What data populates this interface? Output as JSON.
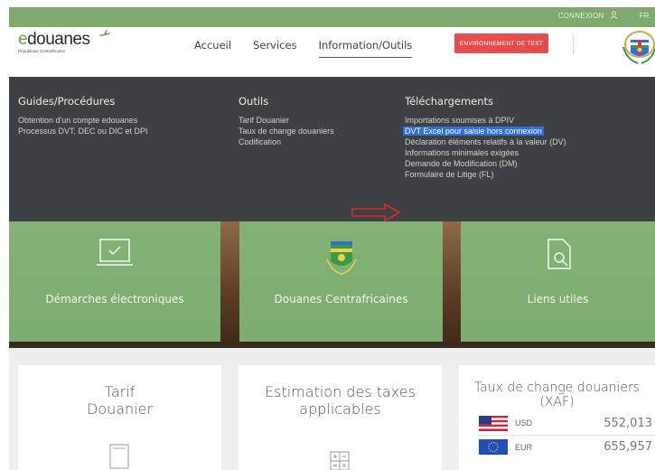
{
  "topbar": {
    "login": "CONNEXION",
    "lang": "FR"
  },
  "logo": {
    "name_e": "e",
    "name_rest": "douanes",
    "subtitle": "République Centrafricaine"
  },
  "nav": {
    "items": [
      "Accueil",
      "Services",
      "Information/Outils"
    ],
    "active": "Information/Outils"
  },
  "env_button": "ENVIRONNEMENT DE TEST",
  "mega_menu": {
    "col1": {
      "title": "Guides/Procédures",
      "items": [
        "Obtention d'un compte edouanes",
        "Processus DVT, DEC ou DIC et DPI"
      ]
    },
    "col2": {
      "title": "Outils",
      "items": [
        "Tarif Douanier",
        "Taux de change douaniers",
        "Codification"
      ]
    },
    "col3": {
      "title": "Téléchargements",
      "items": [
        "Importations soumises à DPIV",
        "DVT Excel pour saisie hors connexion",
        "Déclaration éléments relatifs à la valeur (DV)",
        "Informations minimales exigées",
        "Demande de Modification (DM)",
        "Formulaire de Litige (FL)"
      ]
    }
  },
  "tiles": [
    {
      "label": "Démarches électroniques",
      "icon": "laptop-check-icon"
    },
    {
      "label": "Douanes Centrafricaines",
      "icon": "customs-emblem-icon"
    },
    {
      "label": "Liens utiles",
      "icon": "document-search-icon"
    }
  ],
  "cards": {
    "tarif": {
      "line1": "Tarif",
      "line2": "Douanier"
    },
    "estimation": {
      "line1": "Estimation des taxes",
      "line2": "applicables"
    },
    "rates": {
      "line1": "Taux de change douaniers",
      "line2": "(XAF)",
      "rows": [
        {
          "code": "USD",
          "value": "552,013"
        },
        {
          "code": "EUR",
          "value": "655,957"
        }
      ]
    }
  },
  "colors": {
    "topbar": "#7fa96d",
    "menu": "#3e4143",
    "highlight": "#2f6fd6",
    "env": "#e74c4c",
    "tile": "#82b878"
  }
}
